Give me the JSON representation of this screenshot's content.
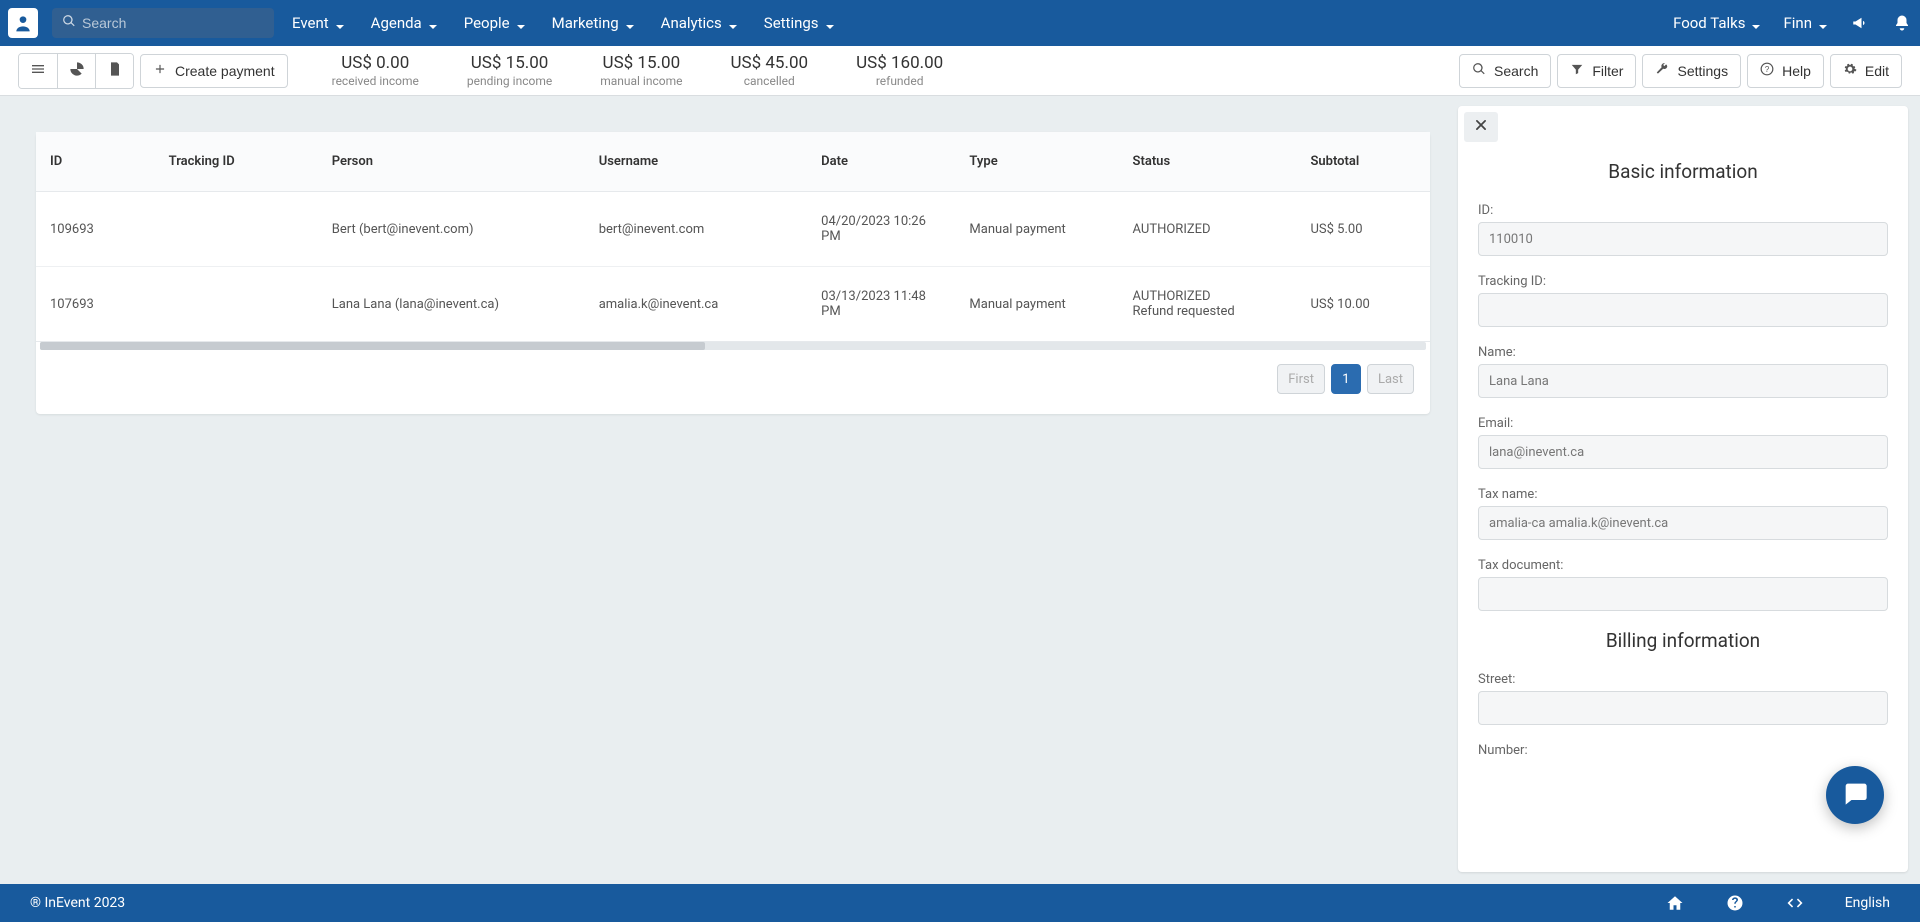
{
  "nav": {
    "searchPlaceholder": "Search",
    "menu": [
      "Event",
      "Agenda",
      "People",
      "Marketing",
      "Analytics",
      "Settings"
    ],
    "right": {
      "org": "Food Talks",
      "user": "Finn"
    }
  },
  "toolbar": {
    "createPayment": "Create payment",
    "summary": [
      {
        "amount": "US$ 0.00",
        "label": "received income"
      },
      {
        "amount": "US$ 15.00",
        "label": "pending income"
      },
      {
        "amount": "US$ 15.00",
        "label": "manual income"
      },
      {
        "amount": "US$ 45.00",
        "label": "cancelled"
      },
      {
        "amount": "US$ 160.00",
        "label": "refunded"
      }
    ],
    "actions": {
      "search": "Search",
      "filter": "Filter",
      "settings": "Settings",
      "help": "Help",
      "edit": "Edit"
    }
  },
  "table": {
    "headers": [
      "ID",
      "Tracking ID",
      "Person",
      "Username",
      "Date",
      "Type",
      "Status",
      "Subtotal"
    ],
    "rows": [
      {
        "id": "109693",
        "tracking": "",
        "person": "Bert (bert@inevent.com)",
        "username": "bert@inevent.com",
        "date": "04/20/2023 10:26 PM",
        "type": "Manual payment",
        "status": "AUTHORIZED",
        "subtotal": "US$ 5.00"
      },
      {
        "id": "107693",
        "tracking": "",
        "person": "Lana Lana (lana@inevent.ca)",
        "username": "amalia.k@inevent.ca",
        "date": "03/13/2023 11:48 PM",
        "type": "Manual payment",
        "status": "AUTHORIZED\nRefund requested",
        "subtotal": "US$ 10.00"
      }
    ]
  },
  "pagination": {
    "first": "First",
    "page": "1",
    "last": "Last"
  },
  "panel": {
    "section1": "Basic information",
    "section2": "Billing information",
    "fields": {
      "idLabel": "ID:",
      "id": "110010",
      "trackingLabel": "Tracking ID:",
      "tracking": "",
      "nameLabel": "Name:",
      "name": "Lana Lana",
      "emailLabel": "Email:",
      "email": "lana@inevent.ca",
      "taxNameLabel": "Tax name:",
      "taxName": "amalia-ca amalia.k@inevent.ca",
      "taxDocLabel": "Tax document:",
      "taxDoc": "",
      "streetLabel": "Street:",
      "street": "",
      "numberLabel": "Number:"
    }
  },
  "footer": {
    "copyright": "® InEvent 2023",
    "lang": "English"
  }
}
